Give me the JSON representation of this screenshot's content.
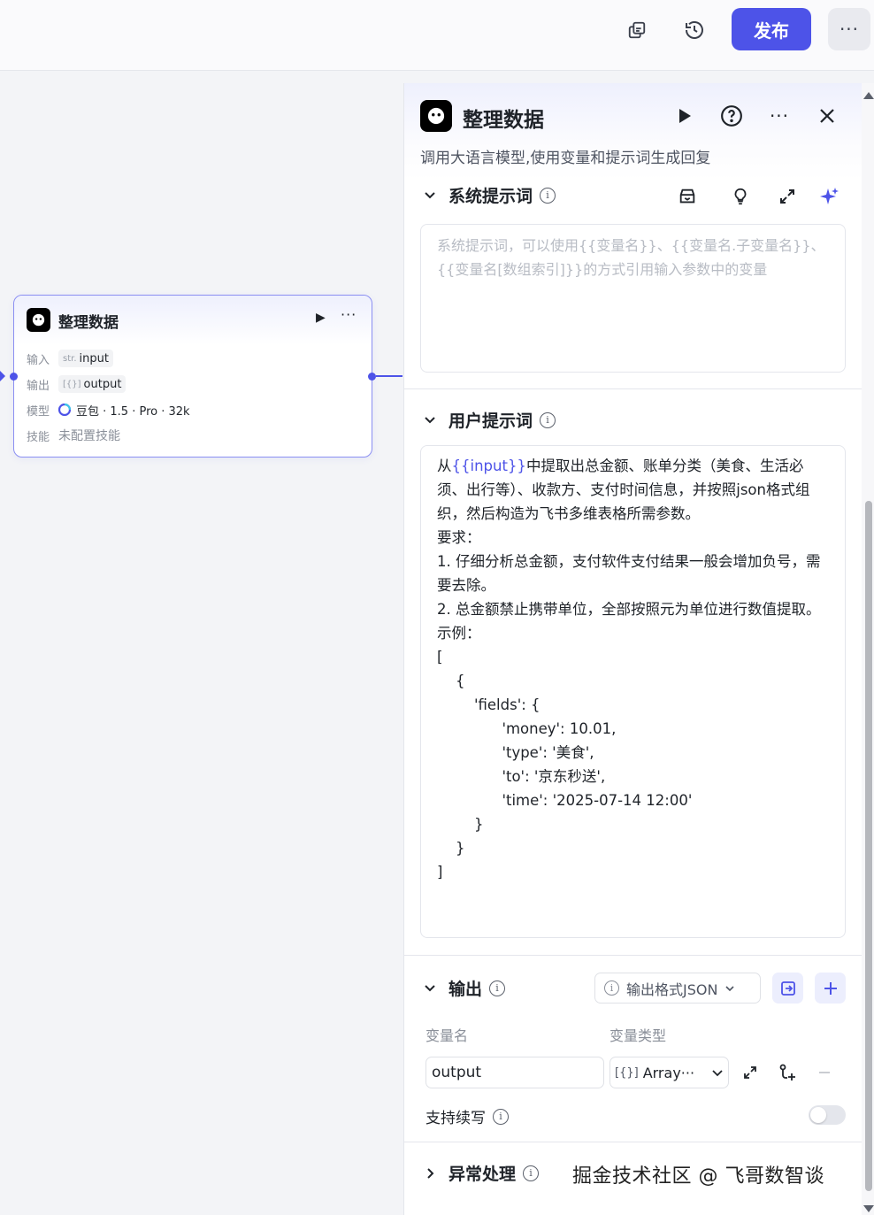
{
  "topbar": {
    "publish_label": "发布",
    "more_label": "···",
    "icons": [
      "copy-icon",
      "history-icon"
    ]
  },
  "node": {
    "title": "整理数据",
    "more_label": "···",
    "input_label": "输入",
    "input_type": "str.",
    "input_value": "input",
    "output_label": "输出",
    "output_type": "[{}]",
    "output_value": "output",
    "model_label": "模型",
    "model_value": "豆包 · 1.5 · Pro · 32k",
    "skill_label": "技能",
    "skill_value": "未配置技能"
  },
  "panel": {
    "title": "整理数据",
    "more_label": "···",
    "description": "调用大语言模型,使用变量和提示词生成回复",
    "system_prompt": {
      "title": "系统提示词",
      "placeholder": "系统提示词，可以使用{{变量名}}、{{变量名.子变量名}}、{{变量名[数组索引]}}的方式引用输入参数中的变量"
    },
    "user_prompt": {
      "title": "用户提示词",
      "prefix": "从",
      "variable": "{{input}}",
      "body": "中提取出总金额、账单分类（美食、生活必须、出行等）、收款方、支付时间信息，并按照json格式组织，然后构造为飞书多维表格所需参数。\n要求：\n1. 仔细分析总金额，支付软件支付结果一般会增加负号，需要去除。\n2. 总金额禁止携带单位，全部按照元为单位进行数值提取。\n示例：\n[\n    {\n        'fields': {\n              'money': 10.01,\n              'type': '美食',\n              'to': '京东秒送',\n              'time': '2025-07-14 12:00'\n        }\n    }\n]"
    },
    "output": {
      "title": "输出",
      "format_label": "输出格式JSON",
      "col_name": "变量名",
      "col_type": "变量类型",
      "var_name": "output",
      "var_type_icon": "[{}]",
      "var_type": "Array···",
      "continue_label": "支持续写",
      "continue_enabled": false
    },
    "exception": {
      "title": "异常处理"
    }
  },
  "watermark": "掘金技术社区 @ 飞哥数智谈",
  "colors": {
    "accent": "#4d53e8",
    "text": "#1f2329",
    "muted": "#8a8f99"
  }
}
